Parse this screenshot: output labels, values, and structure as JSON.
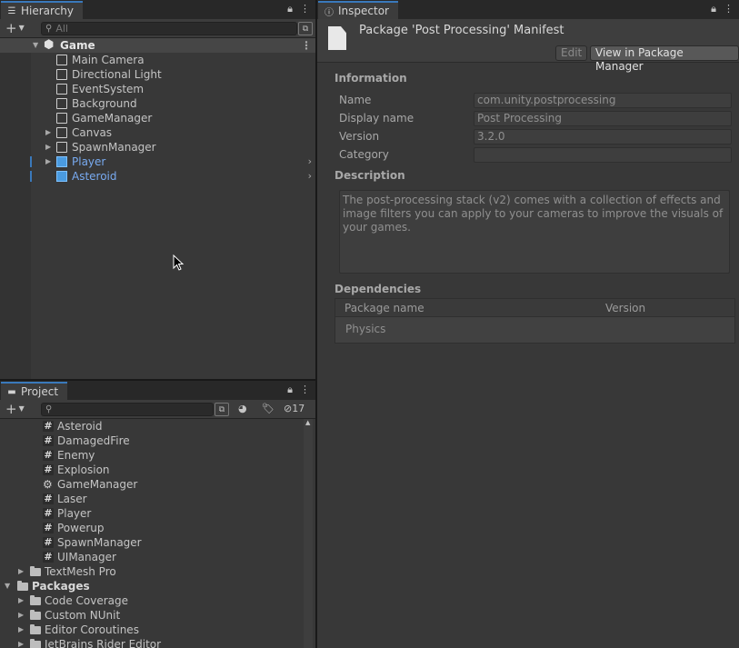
{
  "hierarchy": {
    "tab_label": "Hierarchy",
    "search_placeholder": "All",
    "scene_name": "Game",
    "items": [
      {
        "label": "Main Camera"
      },
      {
        "label": "Directional Light"
      },
      {
        "label": "EventSystem"
      },
      {
        "label": "Background"
      },
      {
        "label": "GameManager"
      },
      {
        "label": "Canvas"
      },
      {
        "label": "SpawnManager"
      },
      {
        "label": "Player"
      },
      {
        "label": "Asteroid"
      }
    ]
  },
  "project": {
    "tab_label": "Project",
    "search_placeholder": "",
    "hidden_count": "17",
    "scripts": [
      {
        "label": "Asteroid"
      },
      {
        "label": "DamagedFire"
      },
      {
        "label": "Enemy"
      },
      {
        "label": "Explosion"
      },
      {
        "label": "GameManager"
      },
      {
        "label": "Laser"
      },
      {
        "label": "Player"
      },
      {
        "label": "Powerup"
      },
      {
        "label": "SpawnManager"
      },
      {
        "label": "UIManager"
      }
    ],
    "folder_textmesh": "TextMesh Pro",
    "packages_label": "Packages",
    "packages": [
      {
        "label": "Code Coverage"
      },
      {
        "label": "Custom NUnit"
      },
      {
        "label": "Editor Coroutines"
      },
      {
        "label": "JetBrains Rider Editor"
      }
    ]
  },
  "inspector": {
    "tab_label": "Inspector",
    "title": "Package 'Post Processing' Manifest",
    "edit_label": "Edit",
    "view_pm_label": "View in Package Manager",
    "information_header": "Information",
    "fields": {
      "name_label": "Name",
      "name_value": "com.unity.postprocessing",
      "display_label": "Display name",
      "display_value": "Post Processing",
      "version_label": "Version",
      "version_value": "3.2.0",
      "category_label": "Category",
      "category_value": ""
    },
    "description_header": "Description",
    "description_text": "The post-processing stack (v2) comes with a collection of effects and image filters you can apply to your cameras to improve the visuals of your games.",
    "dependencies_header": "Dependencies",
    "deps_col_name": "Package name",
    "deps_col_version": "Version",
    "deps_rows": [
      {
        "name": "Physics",
        "version": ""
      }
    ]
  },
  "colors": {
    "accent": "#3a79bb",
    "selected_text": "#78aaf0",
    "panel_bg": "#383838"
  }
}
